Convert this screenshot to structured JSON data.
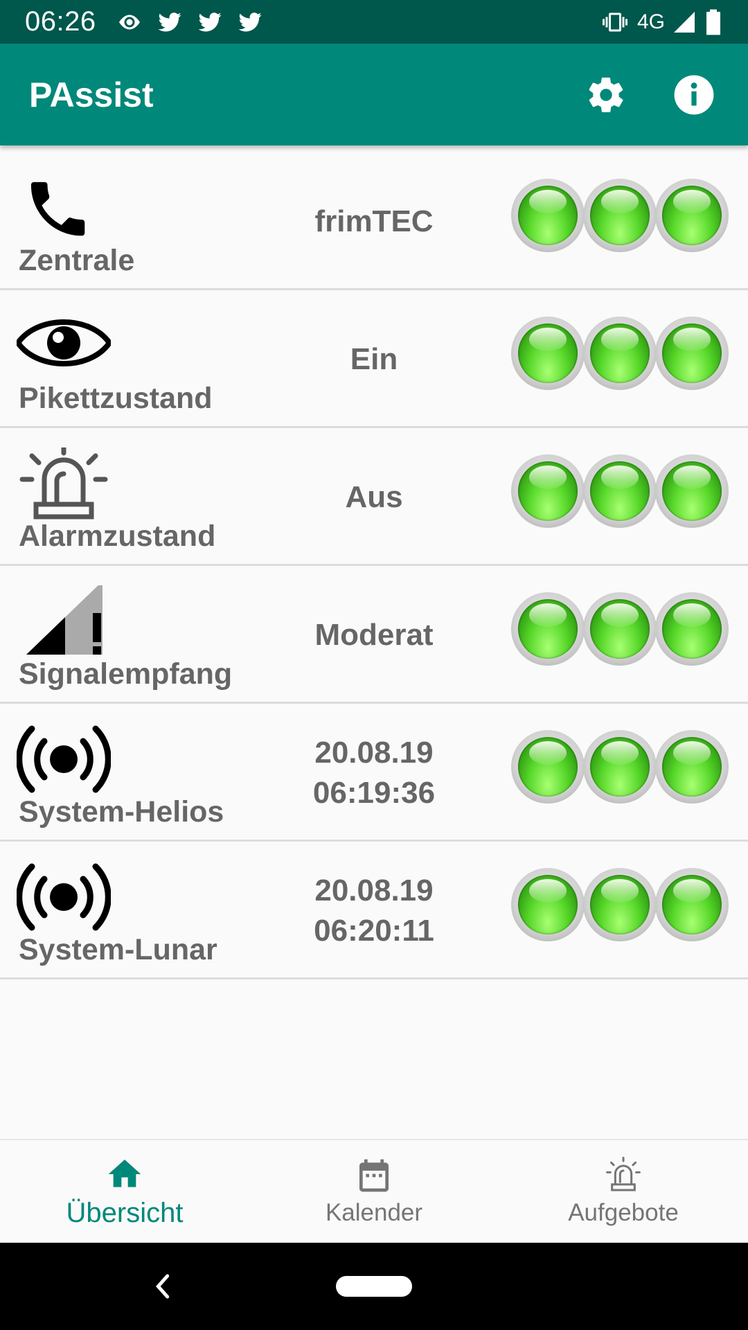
{
  "status_bar": {
    "time": "06:26",
    "network": "4G",
    "icons": [
      "eye-icon",
      "twitter-icon",
      "twitter-icon",
      "twitter-icon",
      "vibrate-icon",
      "signal-icon",
      "battery-icon"
    ]
  },
  "app_bar": {
    "title": "PAssist",
    "actions": [
      "settings-icon",
      "info-icon"
    ]
  },
  "rows": [
    {
      "icon": "phone-icon",
      "label": "Zentrale",
      "value": "frimTEC",
      "leds": [
        "green",
        "green",
        "green"
      ]
    },
    {
      "icon": "eye-icon",
      "label": "Pikettzustand",
      "value": "Ein",
      "leds": [
        "green",
        "green",
        "green"
      ]
    },
    {
      "icon": "alarm-light-icon",
      "label": "Alarmzustand",
      "value": "Aus",
      "leds": [
        "green",
        "green",
        "green"
      ]
    },
    {
      "icon": "signal-alert-icon",
      "label": "Signalempfang",
      "value": "Moderat",
      "leds": [
        "green",
        "green",
        "green"
      ]
    },
    {
      "icon": "broadcast-icon",
      "label": "System-Helios",
      "value": "20.08.19\n06:19:36",
      "leds": [
        "green",
        "green",
        "green"
      ]
    },
    {
      "icon": "broadcast-icon",
      "label": "System-Lunar",
      "value": "20.08.19\n06:20:11",
      "leds": [
        "green",
        "green",
        "green"
      ]
    }
  ],
  "bottom_nav": {
    "items": [
      {
        "label": "Übersicht",
        "icon": "home-icon",
        "active": true
      },
      {
        "label": "Kalender",
        "icon": "calendar-icon",
        "active": false
      },
      {
        "label": "Aufgebote",
        "icon": "alarm-light-icon",
        "active": false
      }
    ]
  },
  "colors": {
    "status_bar": "#00574b",
    "app_bar": "#00887a",
    "accent": "#00887a",
    "text_secondary": "#666666",
    "led_green": "#58d82a"
  }
}
